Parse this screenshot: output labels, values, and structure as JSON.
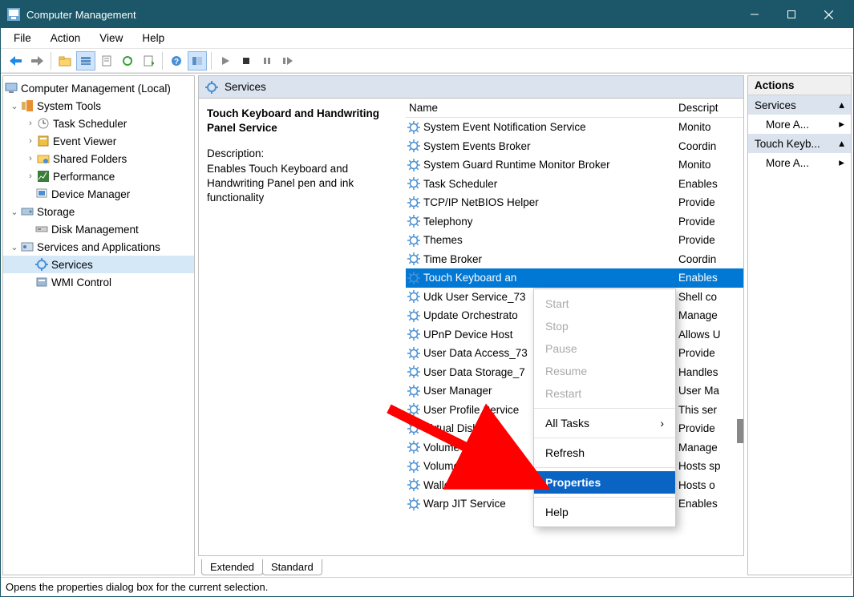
{
  "title": "Computer Management",
  "menubar": [
    "File",
    "Action",
    "View",
    "Help"
  ],
  "tree": {
    "root": "Computer Management (Local)",
    "system_tools": "System Tools",
    "st_children": [
      "Task Scheduler",
      "Event Viewer",
      "Shared Folders",
      "Performance",
      "Device Manager"
    ],
    "storage": "Storage",
    "storage_children": [
      "Disk Management"
    ],
    "sna": "Services and Applications",
    "sna_children": [
      "Services",
      "WMI Control"
    ]
  },
  "services_header": "Services",
  "detail": {
    "name": "Touch Keyboard and Handwriting Panel Service",
    "desc_label": "Description:",
    "desc": "Enables Touch Keyboard and Handwriting Panel pen and ink functionality"
  },
  "columns": {
    "name": "Name",
    "desc": "Descript"
  },
  "rows": [
    {
      "name": "System Event Notification Service",
      "desc": "Monito"
    },
    {
      "name": "System Events Broker",
      "desc": "Coordin"
    },
    {
      "name": "System Guard Runtime Monitor Broker",
      "desc": "Monito"
    },
    {
      "name": "Task Scheduler",
      "desc": "Enables"
    },
    {
      "name": "TCP/IP NetBIOS Helper",
      "desc": "Provide"
    },
    {
      "name": "Telephony",
      "desc": "Provide"
    },
    {
      "name": "Themes",
      "desc": "Provide"
    },
    {
      "name": "Time Broker",
      "desc": "Coordin"
    },
    {
      "name": "Touch Keyboard an",
      "desc": "Enables",
      "selected": true
    },
    {
      "name": "Udk User Service_73",
      "desc": "Shell co"
    },
    {
      "name": "Update Orchestrato",
      "desc": "Manage"
    },
    {
      "name": "UPnP Device Host",
      "desc": "Allows U"
    },
    {
      "name": "User Data Access_73",
      "desc": "Provide"
    },
    {
      "name": "User Data Storage_7",
      "desc": "Handles"
    },
    {
      "name": "User Manager",
      "desc": "User Ma"
    },
    {
      "name": "User Profile Service",
      "desc": "This ser"
    },
    {
      "name": "Virtual Disk",
      "desc": "Provide"
    },
    {
      "name": "Volume Shadow Co",
      "desc": "Manage"
    },
    {
      "name": "Volumetric Audio",
      "desc": "Hosts sp"
    },
    {
      "name": "WalletService",
      "desc": "Hosts o"
    },
    {
      "name": "Warp JIT Service",
      "desc": "Enables"
    }
  ],
  "tabs": [
    "Extended",
    "Standard"
  ],
  "actions": {
    "title": "Actions",
    "sec1": "Services",
    "more": "More A...",
    "sec2": "Touch Keyb..."
  },
  "context_menu": {
    "start": "Start",
    "stop": "Stop",
    "pause": "Pause",
    "resume": "Resume",
    "restart": "Restart",
    "all_tasks": "All Tasks",
    "refresh": "Refresh",
    "properties": "Properties",
    "help": "Help"
  },
  "statusbar": "Opens the properties dialog box for the current selection."
}
